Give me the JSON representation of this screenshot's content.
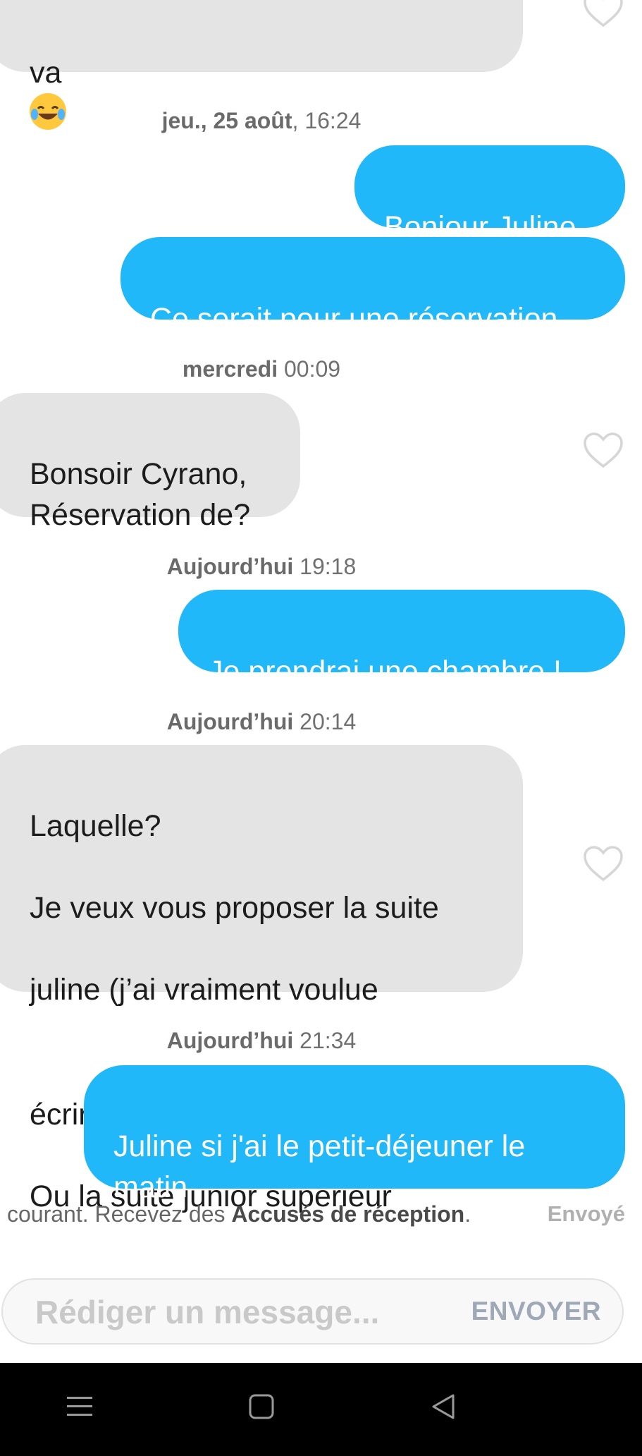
{
  "messages": {
    "m0": {
      "line2": "va"
    },
    "ts1": {
      "prefix": "jeu., 25 août",
      "time": ", 16:24"
    },
    "m1": {
      "text": "Bonjour Juline"
    },
    "m2": {
      "text": "Ce serait pour une réservation"
    },
    "ts2": {
      "prefix": "mercredi",
      "time": " 00:09"
    },
    "m3": {
      "text": "Bonsoir Cyrano,\nRéservation de?"
    },
    "ts3": {
      "prefix": "Aujourd’hui",
      "time": " 19:18"
    },
    "m4": {
      "text": "Je prendrai une chambre !"
    },
    "ts4": {
      "prefix": "Aujourd’hui",
      "time": " 20:14"
    },
    "m5": {
      "line1": "Laquelle?",
      "line2": "Je veux vous proposer la suite",
      "line3": "juline (j’ai vraiment voulue",
      "line4a": "écrire junior ",
      "line4b": ")",
      "line5": "Ou la suite junior supérieur"
    },
    "ts5": {
      "prefix": "Aujourd’hui",
      "time": " 21:34"
    },
    "m6": {
      "text": "Juline si j'ai le petit-déjeuner le\nmatin"
    }
  },
  "footer": {
    "note_prefix": "courant. Recevez des ",
    "note_link": "Accusés de réception",
    "note_suffix": ".",
    "status": "Envoyé"
  },
  "composer": {
    "placeholder": "Rédiger un message...",
    "send_label": "ENVOYER"
  },
  "icons": {
    "like": "heart-outline-icon",
    "laugh": "face-with-tears-of-joy-emoji",
    "cry": "loudly-crying-face-emoji"
  },
  "colors": {
    "outgoing": "#21b8f9",
    "incoming": "#e4e4e4",
    "send": "#9fa8b6"
  }
}
